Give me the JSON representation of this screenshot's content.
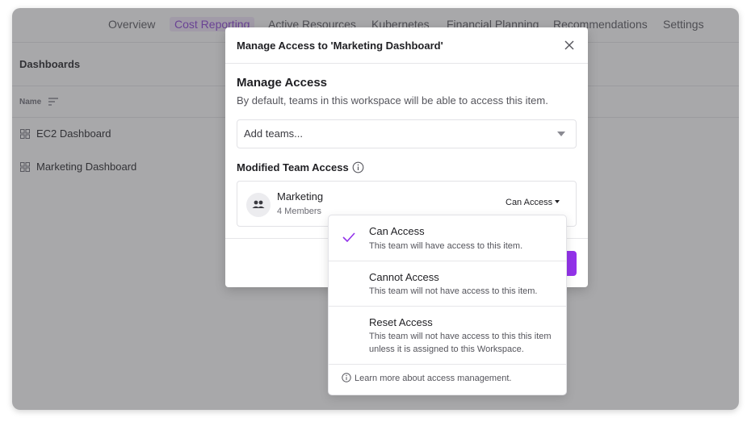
{
  "nav": {
    "tabs": [
      {
        "label": "Overview"
      },
      {
        "label": "Cost Reporting",
        "active": true
      },
      {
        "label": "Active Resources"
      },
      {
        "label": "Kubernetes"
      },
      {
        "label": "Financial Planning"
      },
      {
        "label": "Recommendations"
      },
      {
        "label": "Settings"
      }
    ]
  },
  "dashboards": {
    "title": "Dashboards",
    "column_header": "Name",
    "rows": [
      {
        "label": "EC2 Dashboard",
        "icon": "dashboard-grid-icon"
      },
      {
        "label": "Marketing Dashboard",
        "icon": "dashboard-grid-icon"
      }
    ]
  },
  "modal": {
    "title": "Manage Access to 'Marketing Dashboard'",
    "heading": "Manage Access",
    "description": "By default, teams in this workspace will be able to access this item.",
    "add_teams_placeholder": "Add teams...",
    "modified_label": "Modified Team Access",
    "team": {
      "name": "Marketing",
      "members": "4 Members",
      "access": "Can Access"
    }
  },
  "dropdown": {
    "options": [
      {
        "title": "Can Access",
        "description": "This team will have access to this item.",
        "selected": true
      },
      {
        "title": "Cannot Access",
        "description": "This team will not have access to this item.",
        "selected": false
      },
      {
        "title": "Reset Access",
        "description": "This team will not have access to this this item unless it is assigned to this Workspace.",
        "selected": false
      }
    ],
    "learn_more": "Learn more about access management."
  },
  "colors": {
    "accent": "#9333ea",
    "active_tab_text": "#8a3fd6",
    "active_tab_bg": "#f1e7fb"
  }
}
